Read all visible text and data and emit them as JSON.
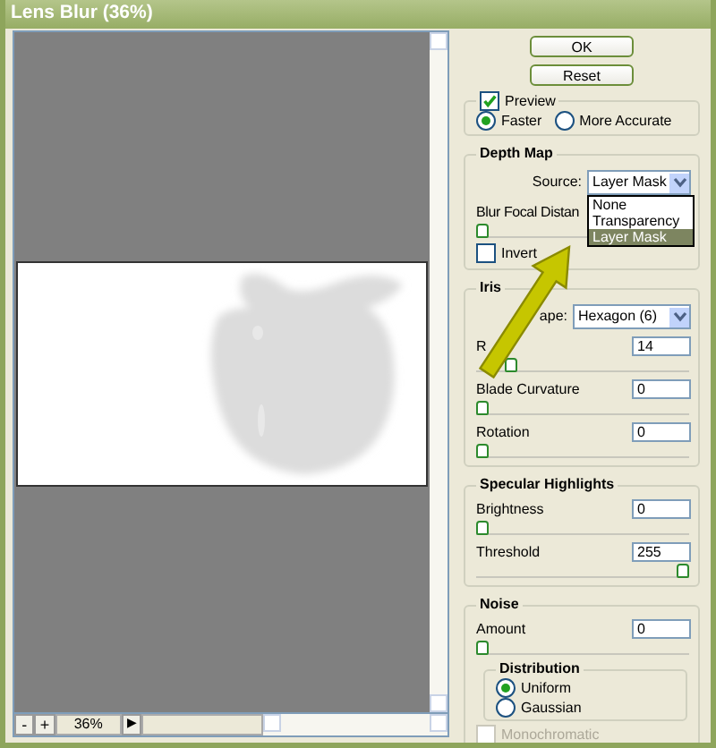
{
  "window": {
    "title": "Lens Blur (36%)"
  },
  "buttons": [
    {
      "label": "OK"
    },
    {
      "label": "Reset"
    }
  ],
  "preview": {
    "label": "Preview",
    "checked": true,
    "modes": [
      {
        "label": "Faster",
        "selected": true
      },
      {
        "label": "More Accurate",
        "selected": false
      }
    ]
  },
  "depth_map": {
    "title": "Depth Map",
    "source_label": "Source:",
    "source_value": "Layer Mask",
    "options": [
      {
        "label": "None",
        "selected": false
      },
      {
        "label": "Transparency",
        "selected": false
      },
      {
        "label": "Layer Mask",
        "selected": true
      }
    ],
    "focal_label": "Blur Focal Distan",
    "focal_slider": {
      "level": 0
    },
    "invert": {
      "label": "Invert",
      "checked": false
    }
  },
  "iris": {
    "title": "Iris",
    "shape_label": "ape:",
    "shape_value": "Hexagon (6)",
    "sliders": [
      {
        "label": "R",
        "value": "14",
        "level": 0.14
      },
      {
        "label": "Blade Curvature",
        "value": "0",
        "level": 0
      },
      {
        "label": "Rotation",
        "value": "0",
        "level": 0
      }
    ]
  },
  "specular": {
    "title": "Specular Highlights",
    "sliders": [
      {
        "label": "Brightness",
        "value": "0",
        "level": 0
      },
      {
        "label": "Threshold",
        "value": "255",
        "level": 1
      }
    ]
  },
  "noise": {
    "title": "Noise",
    "sliders": [
      {
        "label": "Amount",
        "value": "0",
        "level": 0
      }
    ],
    "distribution": {
      "title": "Distribution",
      "options": [
        {
          "label": "Uniform",
          "selected": true
        },
        {
          "label": "Gaussian",
          "selected": false
        }
      ]
    },
    "monochromatic": {
      "label": "Monochromatic",
      "checked": false,
      "disabled": true
    }
  },
  "zoom_bar": {
    "minus": "-",
    "plus": "+",
    "value": "36%",
    "menu": "▶"
  }
}
